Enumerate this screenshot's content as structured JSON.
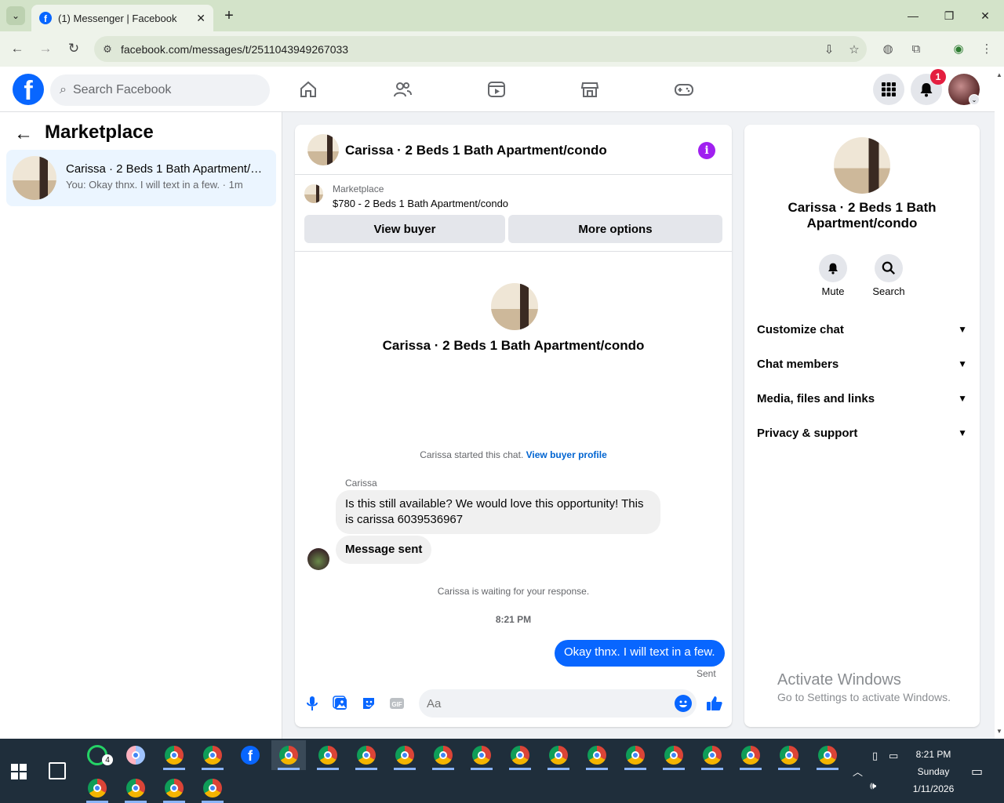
{
  "browser": {
    "tab_title": "(1) Messenger | Facebook",
    "url": "facebook.com/messages/t/2511043949267033"
  },
  "fb_header": {
    "search_placeholder": "Search Facebook",
    "notification_count": "1"
  },
  "left_panel": {
    "title": "Marketplace",
    "conversations": [
      {
        "name": "Carissa · 2 Beds 1 Bath Apartment/condo",
        "preview": "You: Okay thnx. I will text in a few. · 1m"
      }
    ]
  },
  "chat": {
    "header_name": "Carissa · 2 Beds 1 Bath Apartment/condo",
    "marketplace_label": "Marketplace",
    "listing": "$780 - 2 Beds 1 Bath Apartment/condo",
    "view_buyer": "View buyer",
    "more_options": "More options",
    "intro_name": "Carissa · 2 Beds 1 Bath Apartment/condo",
    "started_text": "Carissa started this chat.",
    "view_buyer_profile": "View buyer profile",
    "sender": "Carissa",
    "message_1": "Is this still available? We would love this opportunity! This is carissa 6039536967",
    "message_2": "Message sent",
    "waiting": "Carissa is waiting for your response.",
    "timestamp": "8:21 PM",
    "outgoing": "Okay thnx. I will text in a few.",
    "status": "Sent",
    "composer_placeholder": "Aa"
  },
  "info_panel": {
    "name": "Carissa · 2 Beds 1 Bath Apartment/condo",
    "mute": "Mute",
    "search": "Search",
    "sections": [
      "Customize chat",
      "Chat members",
      "Media, files and links",
      "Privacy & support"
    ]
  },
  "watermark": {
    "line1": "Activate Windows",
    "line2": "Go to Settings to activate Windows."
  },
  "taskbar": {
    "whatsapp_badge": "4",
    "time": "8:21 PM",
    "day": "Sunday",
    "date": "1/11/2026"
  },
  "colors": {
    "fb_blue": "#0866ff",
    "info_purple": "#a020f0",
    "selected_row": "#ebf5ff"
  }
}
